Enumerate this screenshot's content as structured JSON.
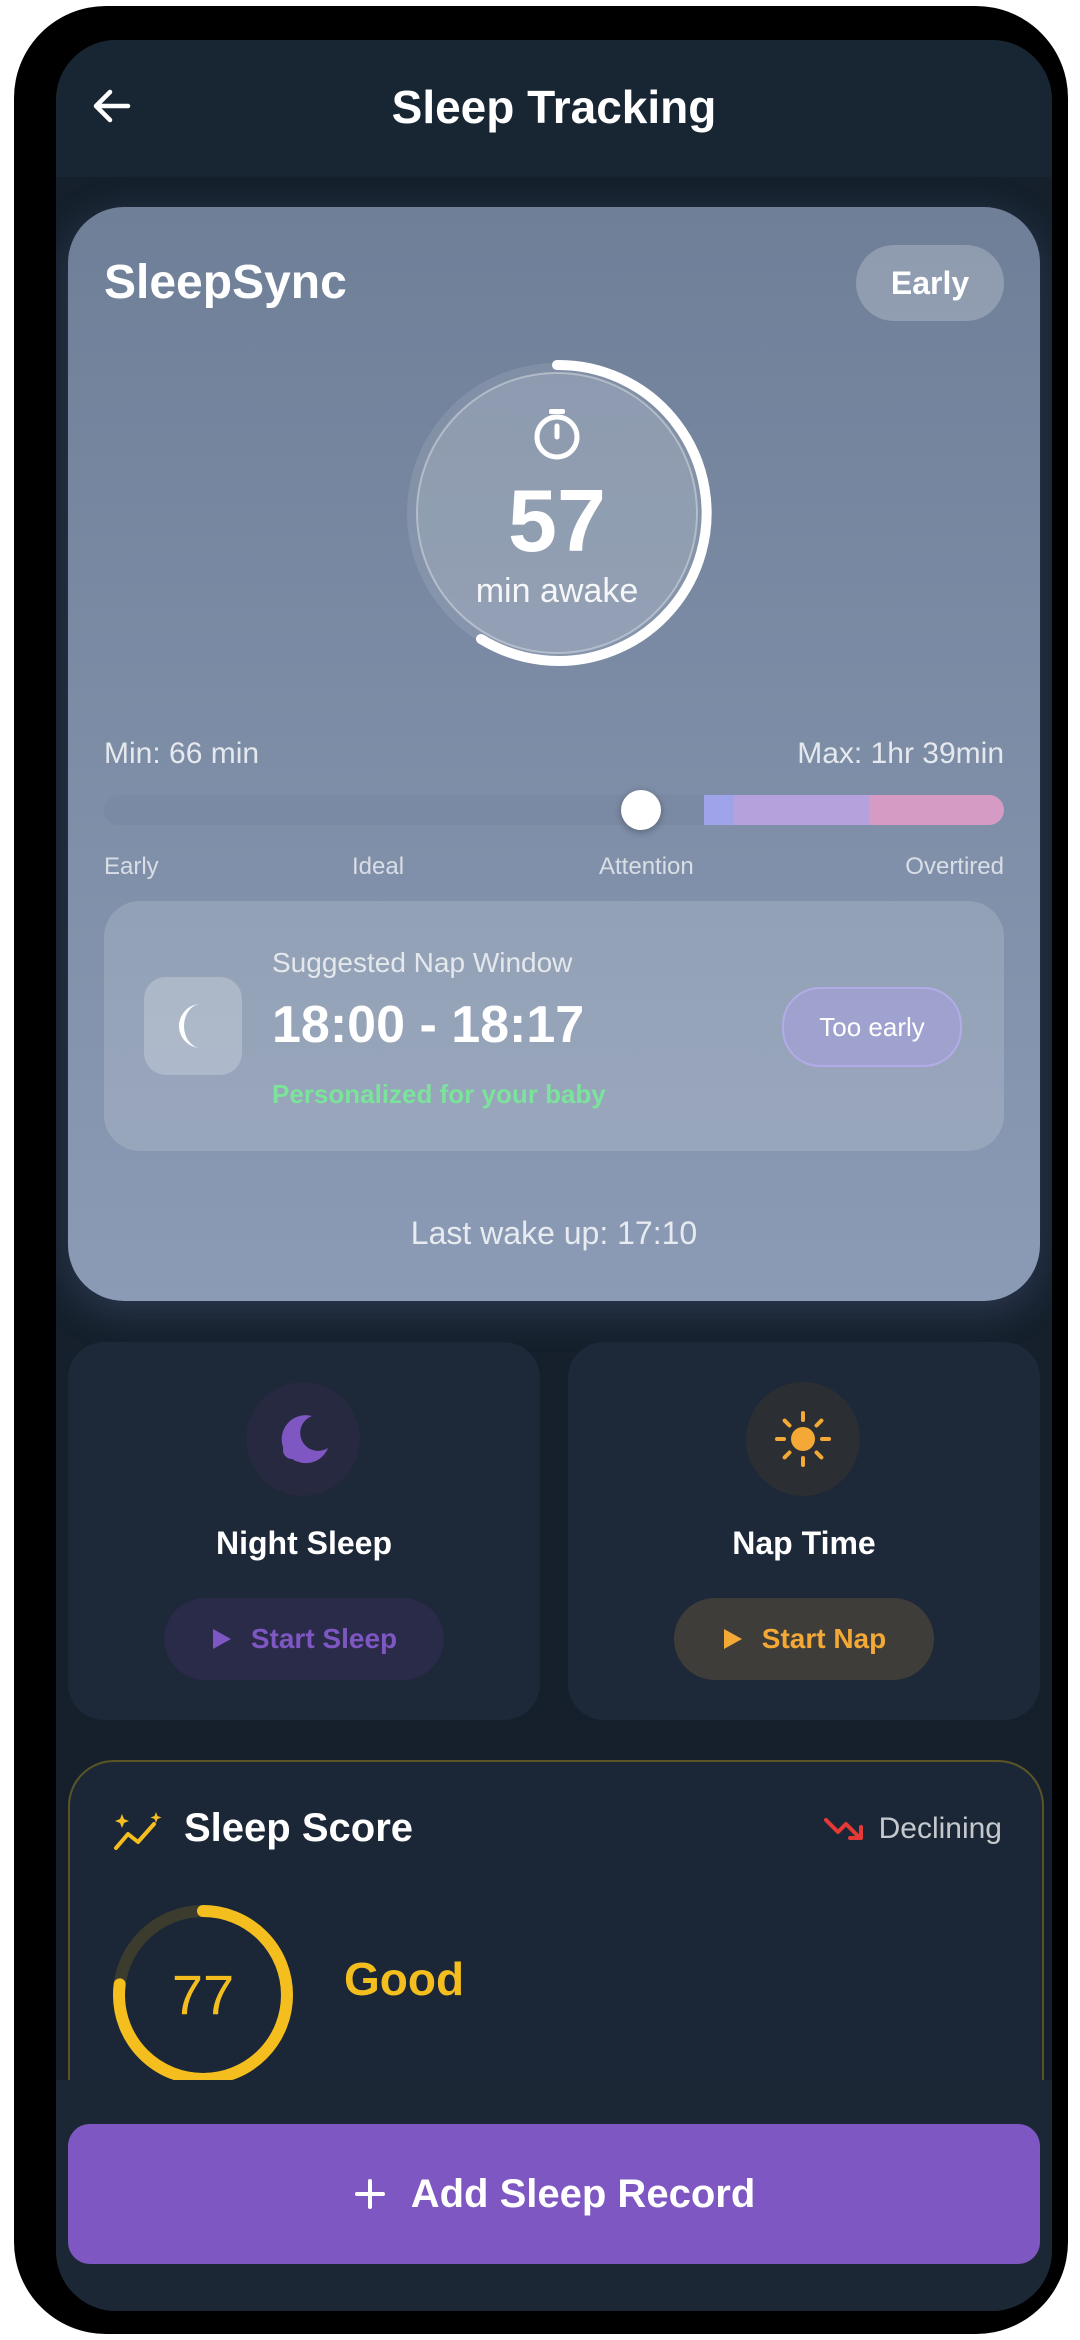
{
  "header": {
    "title": "Sleep Tracking"
  },
  "tracker": {
    "brand": "SleepSync",
    "state_badge": "Early",
    "awake_minutes": "57",
    "awake_label": "min awake",
    "min_label": "Min: 66 min",
    "max_label": "Max: 1hr 39min",
    "zones": [
      "Early",
      "Ideal",
      "Attention",
      "Overtired"
    ],
    "colors": {
      "bar_track": "#7a879d",
      "bar_purple_light": "#9ea3ea",
      "bar_purple": "#b5a2dc",
      "bar_pink": "#d69bc4"
    }
  },
  "nap_window": {
    "title": "Suggested Nap Window",
    "time_range": "18:00 - 18:17",
    "note": "Personalized for your baby",
    "status_button": "Too early"
  },
  "last_wake": "Last wake up: 17:10",
  "night_sleep": {
    "title": "Night Sleep",
    "button_label": "Start Sleep",
    "icon": "moon-icon",
    "accent": "#7e57c2"
  },
  "nap_time": {
    "title": "Nap Time",
    "button_label": "Start Nap",
    "icon": "sun-icon",
    "accent": "#f4a936"
  },
  "sleep_score": {
    "title": "Sleep Score",
    "trend_label": "Declining",
    "score": "77",
    "rating": "Good",
    "accent": "#f4be1f"
  },
  "footer": {
    "add_label": "Add Sleep Record"
  }
}
